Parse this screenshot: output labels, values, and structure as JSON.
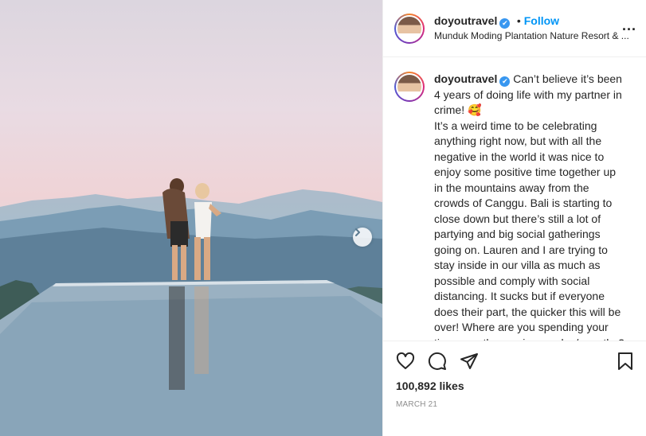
{
  "header": {
    "username": "doyoutravel",
    "separator": "•",
    "follow_label": "Follow",
    "location": "Munduk Moding Plantation Nature Resort & ...",
    "more_label": "..."
  },
  "caption": {
    "username": "doyoutravel",
    "paragraph1": "Can’t believe it’s been 4 years of doing life with my partner in crime! 🥰",
    "paragraph2": "It’s a weird time to be celebrating anything right now, but with all the negative in the world it was nice to enjoy some positive time together up in the mountains away from the crowds of Canggu. Bali is starting to close down but there’s still a lot of partying and big social gatherings going on. Lauren and I are trying to stay inside in our villa as much as possible and comply with social distancing. It sucks but if everyone does their part, the quicker this will be over! Where are you spending your time over the coming weeks / months? Hope you’re all staying safe! 🙏🏼"
  },
  "footer": {
    "likes": "100,892 likes",
    "date": "MARCH 21"
  },
  "icons": {
    "like": "heart-icon",
    "comment": "comment-icon",
    "share": "share-icon",
    "save": "bookmark-icon",
    "next": "chevron-right-icon",
    "verified": "verified-badge-icon"
  },
  "colors": {
    "follow": "#0095f6",
    "verified": "#3897f0",
    "text": "#262626",
    "muted": "#8e8e8e"
  }
}
